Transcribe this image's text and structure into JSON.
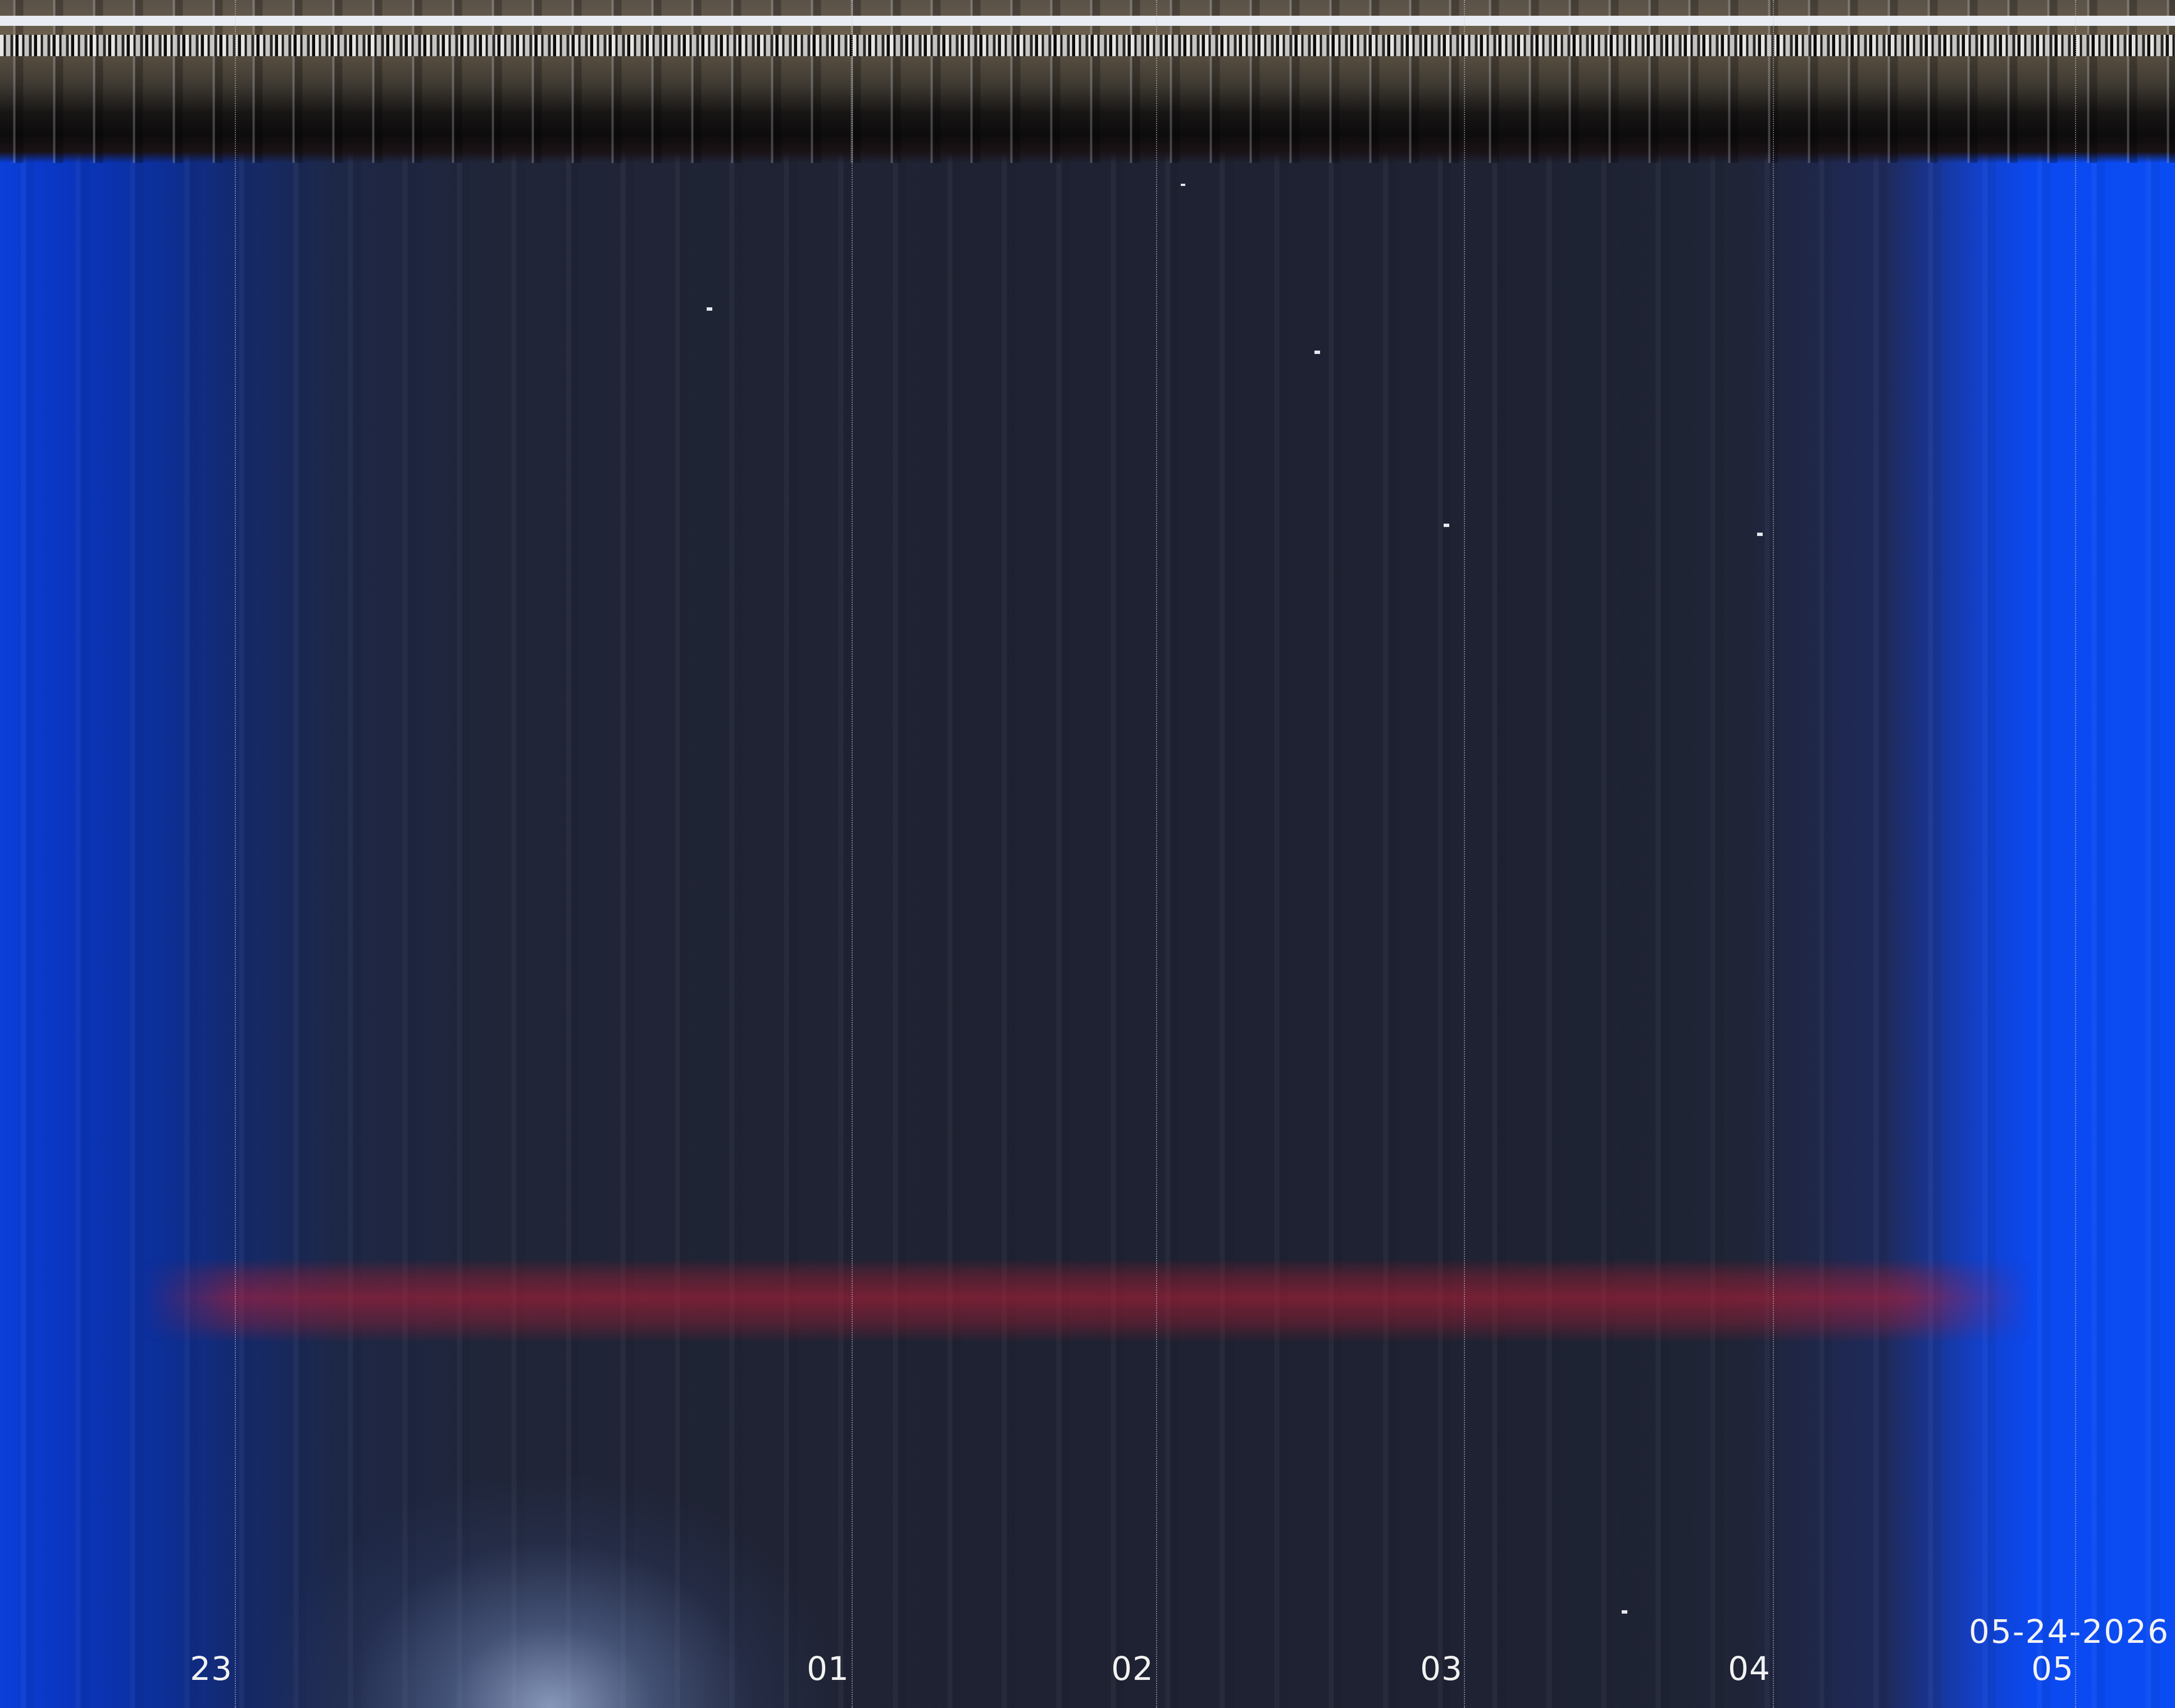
{
  "image": {
    "kind": "all-sky keogram",
    "date_label": "05-24-2026",
    "hour_labels": [
      "23",
      "01",
      "02",
      "03",
      "04",
      "05"
    ],
    "colors": {
      "edge_blue": "#0a4cf4",
      "night_sky": "#1e2232",
      "red_band": "#be1e37",
      "label_text": "#f2f2f2"
    }
  }
}
